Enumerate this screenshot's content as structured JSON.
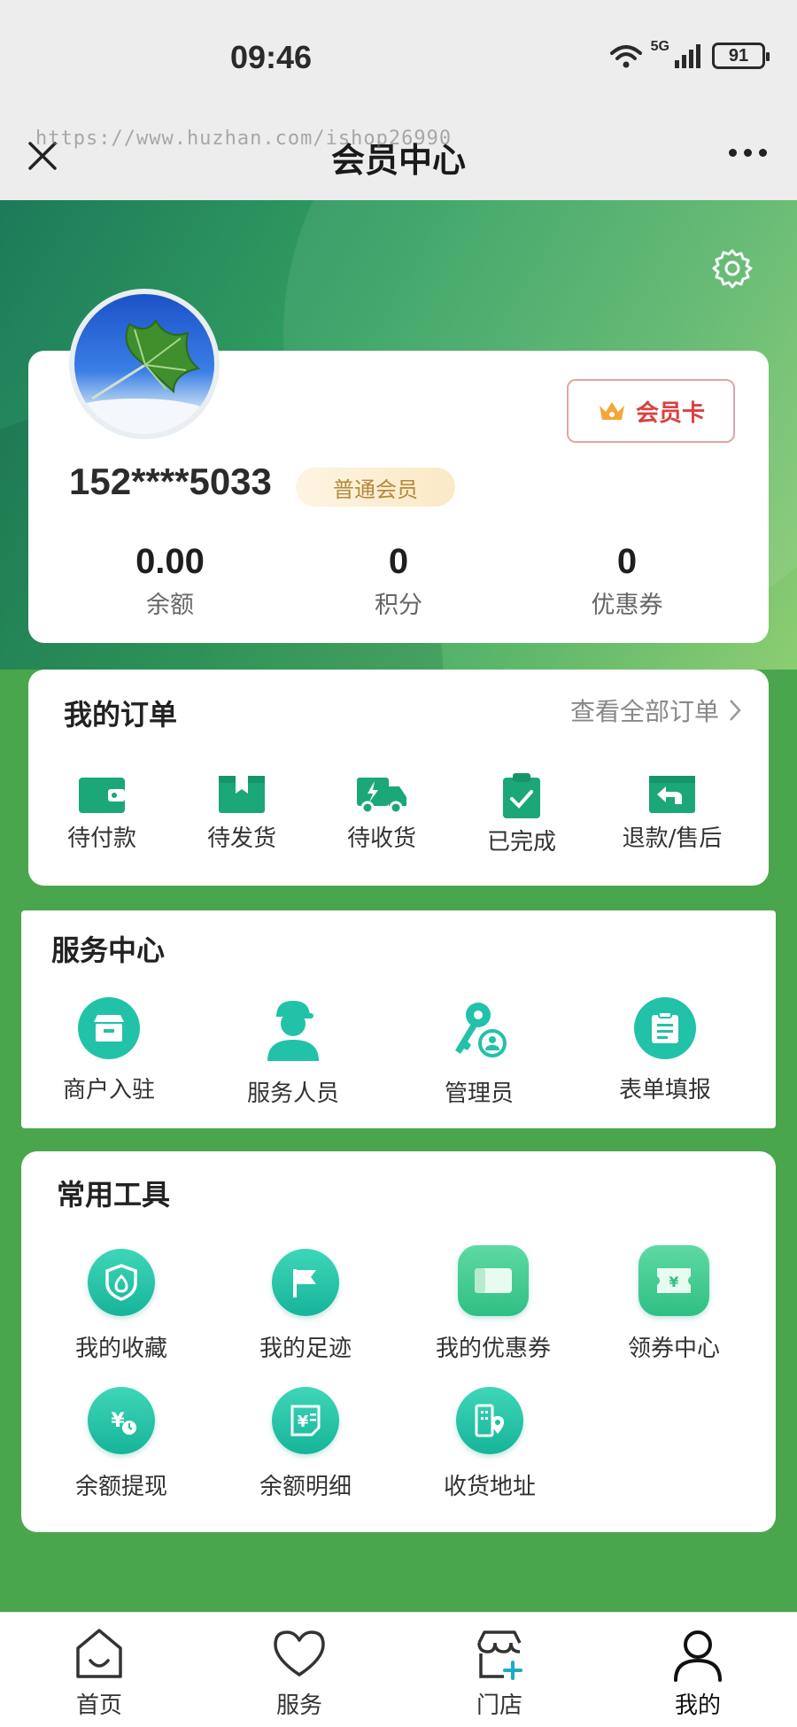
{
  "status": {
    "time": "09:46",
    "network": "5G",
    "battery": "91"
  },
  "nav": {
    "title": "会员中心",
    "watermark": "https://www.huzhan.com/ishop26990"
  },
  "member": {
    "vip_card_label": "会员卡",
    "phone": "152****5033",
    "level": "普通会员",
    "stats": [
      {
        "value": "0.00",
        "label": "余额"
      },
      {
        "value": "0",
        "label": "积分"
      },
      {
        "value": "0",
        "label": "优惠券"
      }
    ]
  },
  "orders": {
    "title": "我的订单",
    "view_all": "查看全部订单",
    "items": [
      {
        "label": "待付款",
        "icon": "wallet-icon"
      },
      {
        "label": "待发货",
        "icon": "box-icon"
      },
      {
        "label": "待收货",
        "icon": "truck-icon"
      },
      {
        "label": "已完成",
        "icon": "clipboard-check-icon"
      },
      {
        "label": "退款/售后",
        "icon": "return-icon"
      }
    ]
  },
  "service": {
    "title": "服务中心",
    "items": [
      {
        "label": "商户入驻",
        "icon": "store-icon"
      },
      {
        "label": "服务人员",
        "icon": "staff-icon"
      },
      {
        "label": "管理员",
        "icon": "key-user-icon"
      },
      {
        "label": "表单填报",
        "icon": "form-icon"
      }
    ]
  },
  "tools": {
    "title": "常用工具",
    "items": [
      {
        "label": "我的收藏",
        "icon": "favorite-shield-icon"
      },
      {
        "label": "我的足迹",
        "icon": "flag-icon"
      },
      {
        "label": "我的优惠券",
        "icon": "coupon-icon"
      },
      {
        "label": "领券中心",
        "icon": "coupon-center-icon"
      },
      {
        "label": "余额提现",
        "icon": "withdraw-icon"
      },
      {
        "label": "余额明细",
        "icon": "balance-detail-icon"
      },
      {
        "label": "收货地址",
        "icon": "address-icon"
      }
    ]
  },
  "tabbar": {
    "items": [
      {
        "label": "首页",
        "icon": "home-icon"
      },
      {
        "label": "服务",
        "icon": "heart-icon"
      },
      {
        "label": "门店",
        "icon": "shop-icon"
      },
      {
        "label": "我的",
        "icon": "user-icon"
      }
    ],
    "active": "我的"
  },
  "colors": {
    "theme_green": "#4aa64c",
    "icon_teal": "#1fbf9f",
    "vip_red": "#d94040",
    "level_gold": "#b5893c"
  }
}
